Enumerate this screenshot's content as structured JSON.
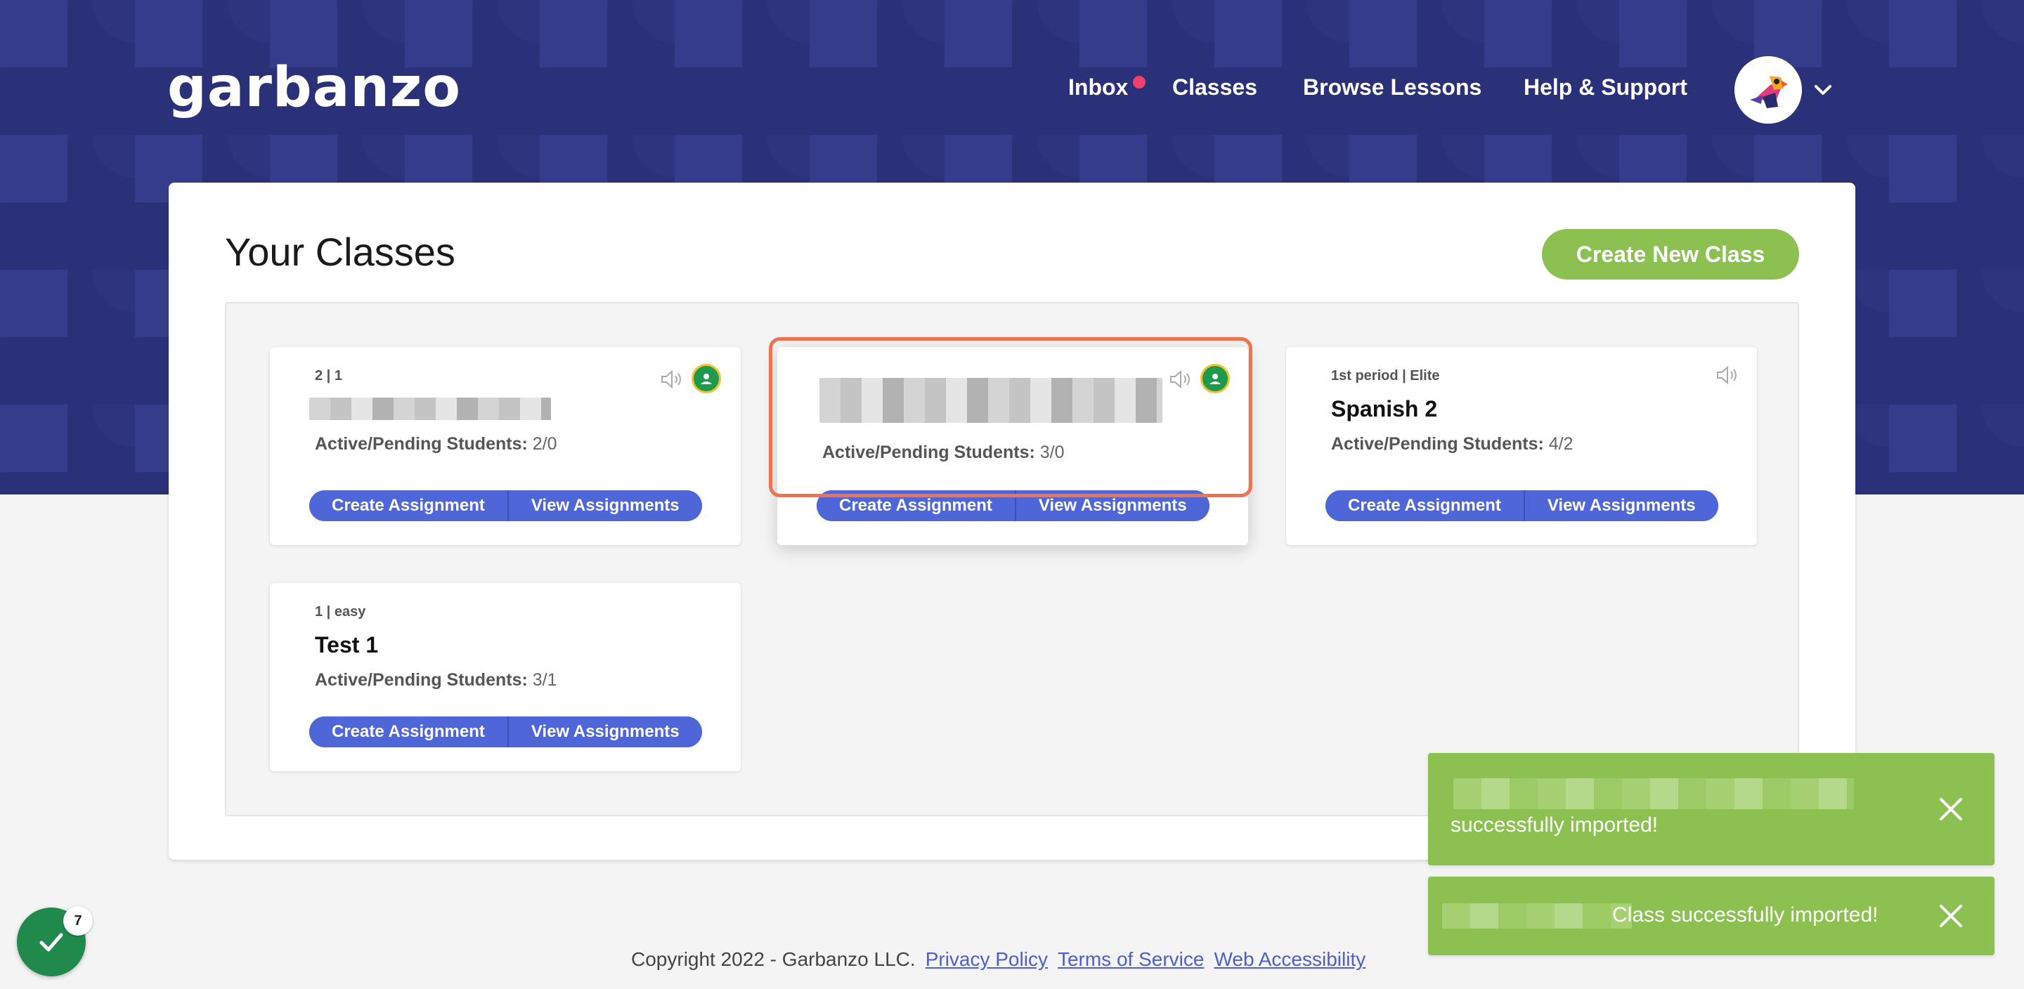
{
  "header": {
    "logo": "garbanzo",
    "nav": [
      {
        "label": "Inbox",
        "has_notification": true
      },
      {
        "label": "Classes"
      },
      {
        "label": "Browse Lessons"
      },
      {
        "label": "Help & Support"
      }
    ]
  },
  "main": {
    "title": "Your Classes",
    "create_button": "Create New Class",
    "classes": [
      {
        "meta": "2  |  1",
        "name": "",
        "students_label": "Active/Pending Students:",
        "students_value": "2/0",
        "google_classroom": true
      },
      {
        "meta": "",
        "name": "",
        "students_label": "Active/Pending Students:",
        "students_value": "3/0",
        "google_classroom": true
      },
      {
        "meta": "1st period  |  Elite",
        "name": "Spanish 2",
        "students_label": "Active/Pending Students:",
        "students_value": "4/2",
        "google_classroom": false
      },
      {
        "meta": "1  |  easy",
        "name": "Test 1",
        "students_label": "Active/Pending Students:",
        "students_value": "3/1",
        "google_classroom": false
      }
    ],
    "create_assignment_label": "Create Assignment",
    "view_assignments_label": "View Assignments"
  },
  "footer": {
    "copyright": "Copyright 2022 - Garbanzo LLC.",
    "links": [
      "Privacy Policy",
      "Terms of Service",
      "Web Accessibility"
    ]
  },
  "toasts": [
    {
      "message": "successfully imported!"
    },
    {
      "message": "Class successfully imported!"
    }
  ],
  "progress_badge": {
    "count": "7"
  },
  "colors": {
    "header_bg": "#2b3178",
    "accent_green": "#8cc152",
    "button_blue": "#4f66d8",
    "notification_pink": "#f2406b",
    "highlight_orange": "#f0734f"
  }
}
